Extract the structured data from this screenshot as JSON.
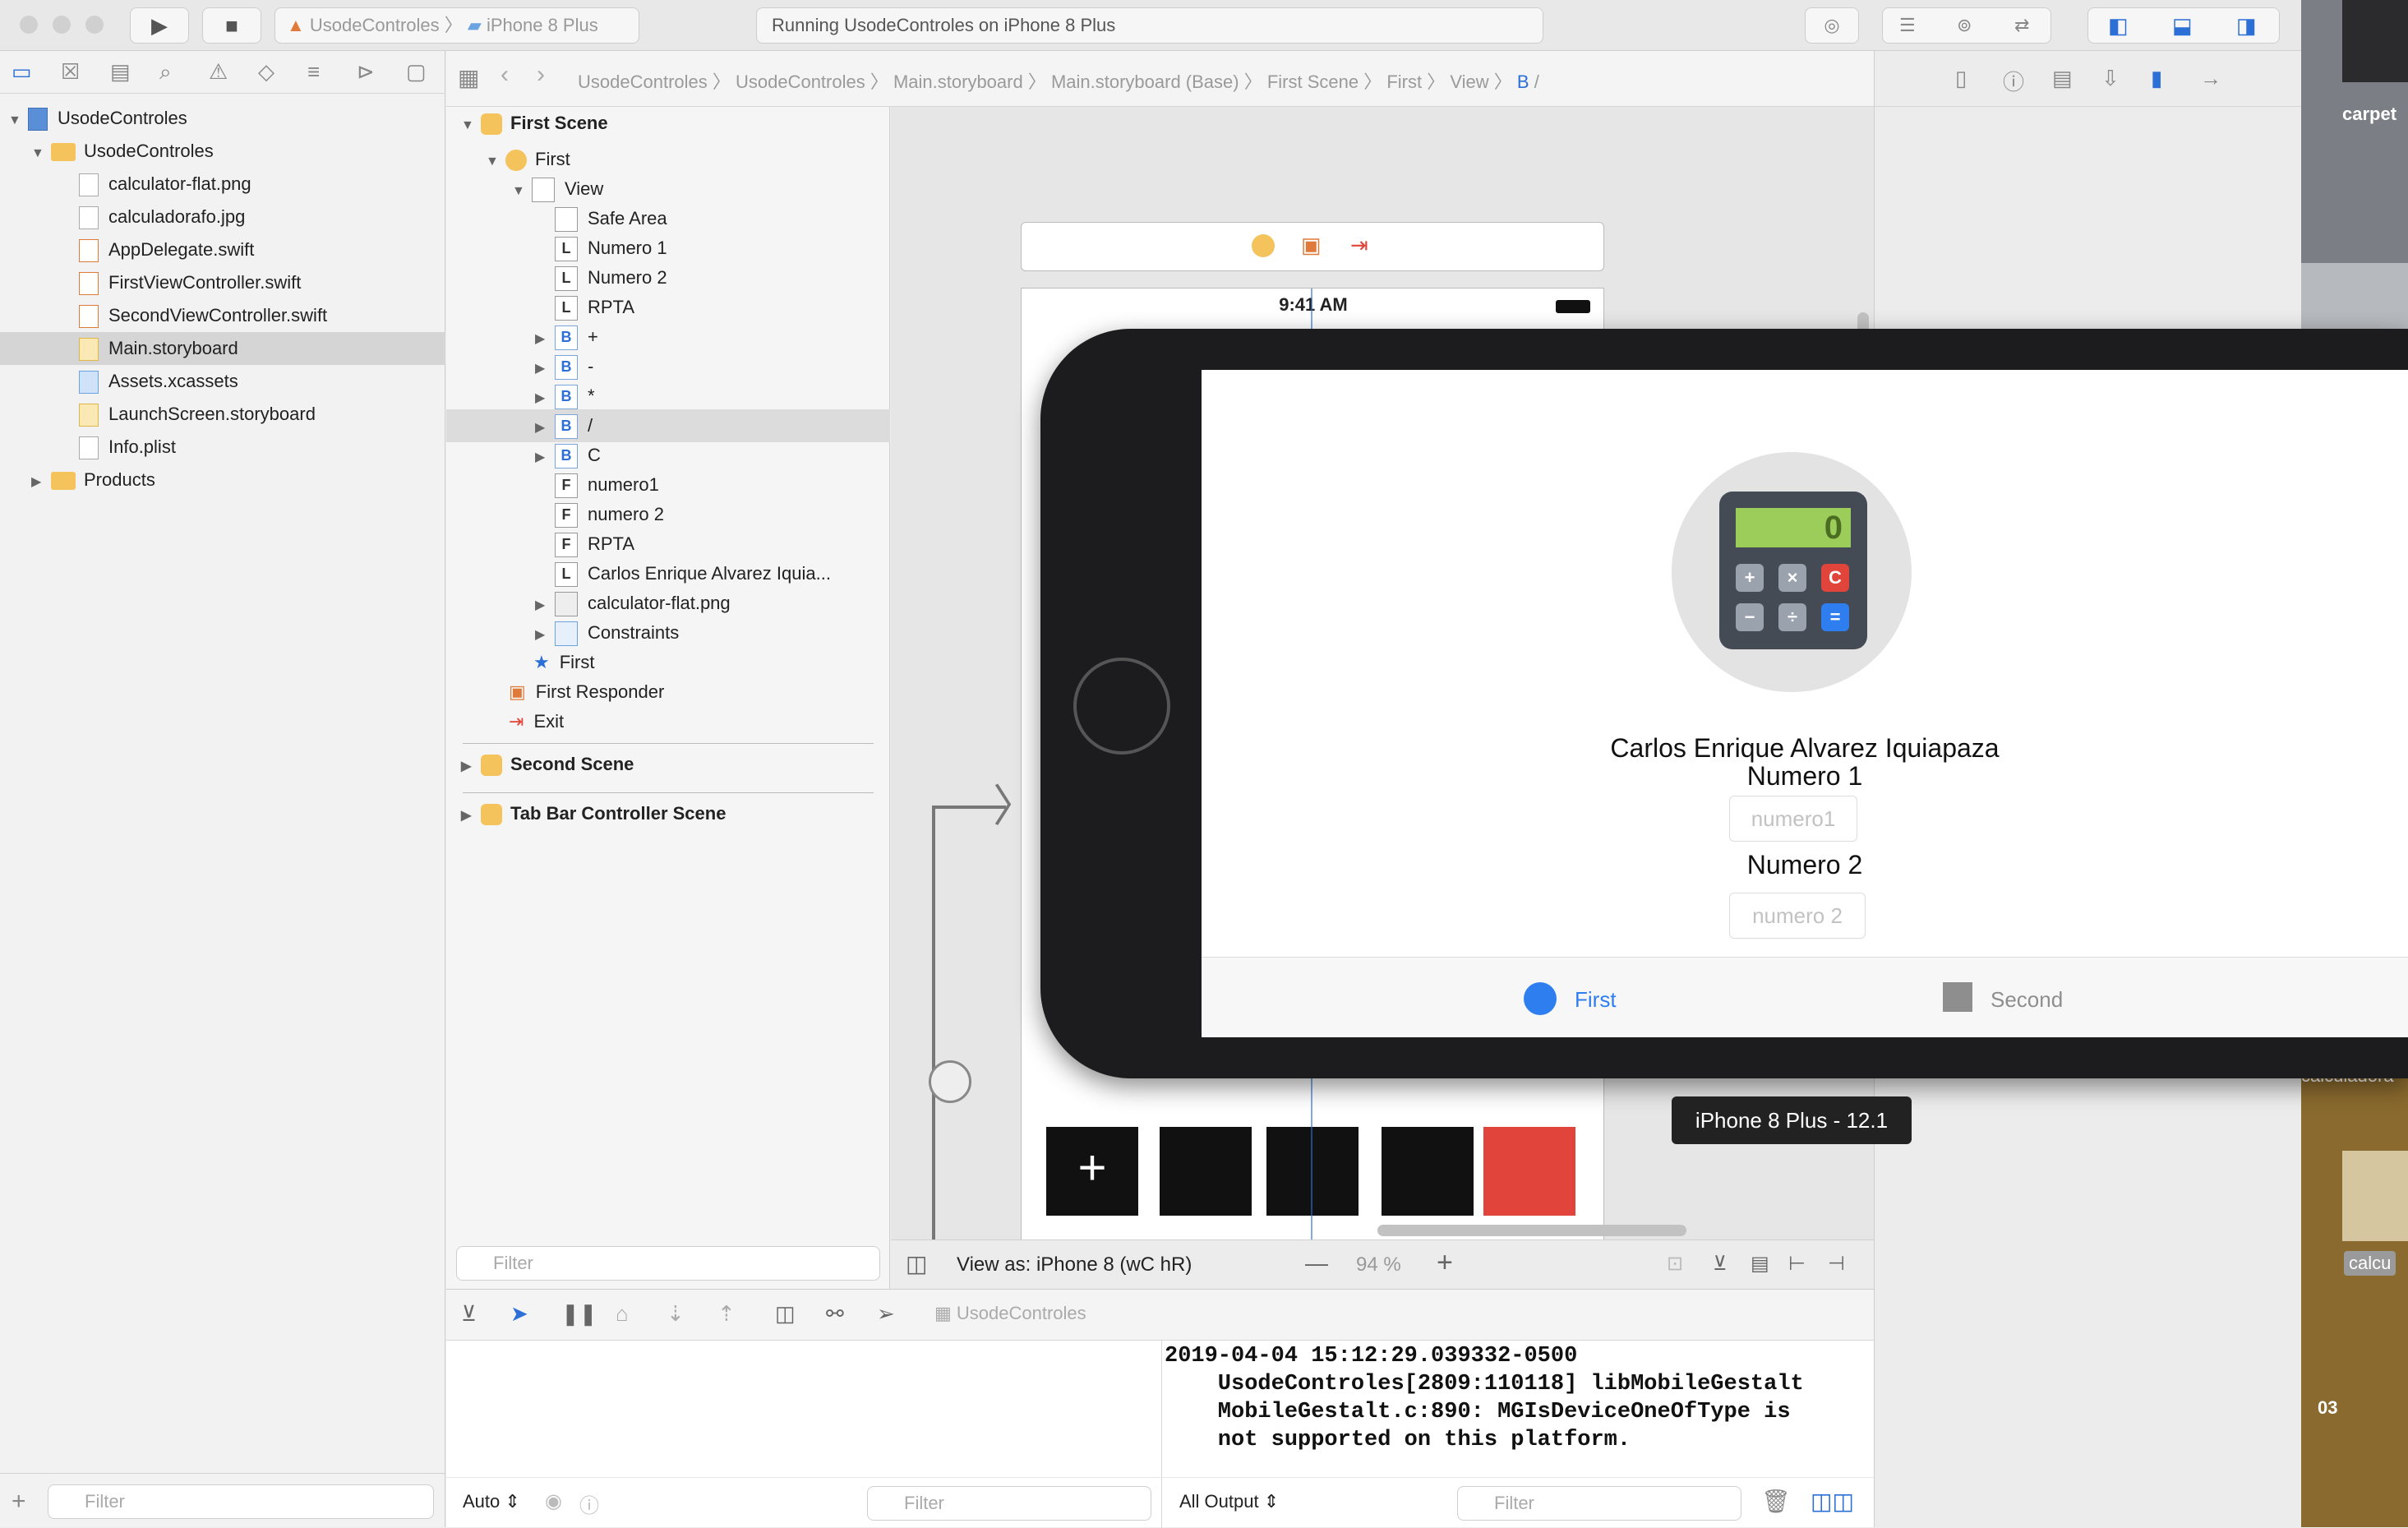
{
  "toolbar": {
    "scheme": "UsodeControles",
    "device": "iPhone 8 Plus",
    "status": "Running UsodeControles on iPhone 8 Plus"
  },
  "navigator": {
    "items": [
      {
        "label": "UsodeControles",
        "level": 0,
        "kind": "project"
      },
      {
        "label": "UsodeControles",
        "level": 1,
        "kind": "folder"
      },
      {
        "label": "calculator-flat.png",
        "level": 2,
        "kind": "file"
      },
      {
        "label": "calculadorafo.jpg",
        "level": 2,
        "kind": "file"
      },
      {
        "label": "AppDelegate.swift",
        "level": 2,
        "kind": "swift"
      },
      {
        "label": "FirstViewController.swift",
        "level": 2,
        "kind": "swift"
      },
      {
        "label": "SecondViewController.swift",
        "level": 2,
        "kind": "swift"
      },
      {
        "label": "Main.storyboard",
        "level": 2,
        "kind": "storyboard"
      },
      {
        "label": "Assets.xcassets",
        "level": 2,
        "kind": "assets"
      },
      {
        "label": "LaunchScreen.storyboard",
        "level": 2,
        "kind": "storyboard"
      },
      {
        "label": "Info.plist",
        "level": 2,
        "kind": "file"
      },
      {
        "label": "Products",
        "level": 1,
        "kind": "folder"
      }
    ],
    "filter_placeholder": "Filter"
  },
  "breadcrumb": [
    "UsodeControles",
    "UsodeControles",
    "Main.storyboard",
    "Main.storyboard (Base)",
    "First Scene",
    "First",
    "View",
    "B",
    "/"
  ],
  "outline": {
    "first_scene": "First Scene",
    "first": "First",
    "view": "View",
    "rows": [
      {
        "badge": "",
        "label": "Safe Area"
      },
      {
        "badge": "L",
        "label": "Numero 1"
      },
      {
        "badge": "L",
        "label": "Numero 2"
      },
      {
        "badge": "L",
        "label": "RPTA"
      },
      {
        "badge": "B",
        "label": "+"
      },
      {
        "badge": "B",
        "label": "-"
      },
      {
        "badge": "B",
        "label": "*"
      },
      {
        "badge": "B",
        "label": "/"
      },
      {
        "badge": "B",
        "label": "C"
      },
      {
        "badge": "F",
        "label": "numero1"
      },
      {
        "badge": "F",
        "label": "numero 2"
      },
      {
        "badge": "F",
        "label": "RPTA"
      },
      {
        "badge": "L",
        "label": "Carlos Enrique Alvarez Iquia..."
      },
      {
        "badge": "img",
        "label": "calculator-flat.png"
      },
      {
        "badge": "con",
        "label": "Constraints"
      }
    ],
    "first_item": "First",
    "first_responder": "First Responder",
    "exit": "Exit",
    "second_scene": "Second Scene",
    "tabbar_scene": "Tab Bar Controller Scene",
    "filter_placeholder": "Filter"
  },
  "canvas": {
    "time": "9:41 AM",
    "view_as": "View as: iPhone 8",
    "size_class": "(wC hR)",
    "zoom": "94 %",
    "minus": "—",
    "plus": "+"
  },
  "simulator": {
    "author": "Carlos Enrique Alvarez Iquiapaza",
    "label1": "Numero 1",
    "field1_placeholder": "numero1",
    "label2": "Numero 2",
    "field2_placeholder": "numero 2",
    "calc_display": "0",
    "tab_first": "First",
    "tab_second": "Second",
    "tooltip": "iPhone 8 Plus - 12.1"
  },
  "debug": {
    "target": "UsodeControles",
    "console_lines": [
      "2019-04-04 15:12:29.039332-0500",
      "    UsodeControles[2809:110118] libMobileGestalt",
      "    MobileGestalt.c:890: MGIsDeviceOneOfType is",
      "    not supported on this platform."
    ],
    "auto": "Auto",
    "all_output": "All Output",
    "filter": "Filter"
  },
  "desktop": {
    "label1": "carpet",
    "label2": "calculadora",
    "label3": "calcu",
    "label4": "03"
  },
  "colors": {
    "accent": "#2c6fd6",
    "storyboard_yellow": "#f4c35b",
    "calc_red": "#e0443a",
    "tab_blue": "#2f7ef0"
  }
}
